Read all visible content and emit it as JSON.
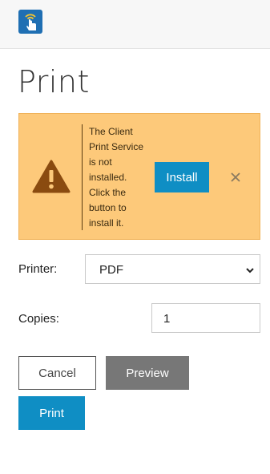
{
  "header": {
    "logo_icon": "print-service-touch-icon",
    "logo_color": "#1f6fb3"
  },
  "page": {
    "title": "Print"
  },
  "alert": {
    "icon": "warning-icon",
    "message": "The Client\nPrint Service\nis not\ninstalled.\nClick the\nbutton to\ninstall it.",
    "install_label": "Install",
    "close_icon": "close-icon",
    "background": "#fdc97a"
  },
  "form": {
    "printer_label": "Printer:",
    "printer_value": "PDF",
    "copies_label": "Copies:",
    "copies_value": "1"
  },
  "actions": {
    "cancel_label": "Cancel",
    "preview_label": "Preview",
    "print_label": "Print",
    "accent": "#0f8ec4"
  }
}
